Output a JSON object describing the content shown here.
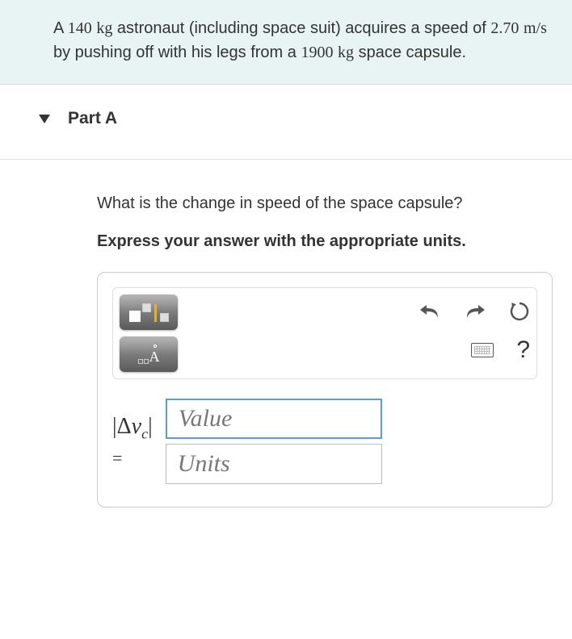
{
  "problem": {
    "mass_astronaut": "140",
    "unit_kg": "kg",
    "text1": "A ",
    "text2": " astronaut (including space suit) acquires a speed of ",
    "speed": "2.70",
    "unit_ms": "m/s",
    "text3": " by pushing off with his legs from a ",
    "mass_capsule": "1900",
    "text4": " space capsule."
  },
  "part": {
    "label": "Part A",
    "question": "What is the change in speed of the space capsule?",
    "instruction": "Express your answer with the appropriate units."
  },
  "answer": {
    "var_abs_open": "|",
    "var_delta": "Δ",
    "var_v": "v",
    "var_sub": "c",
    "var_abs_close": "|",
    "var_eq": "=",
    "value_placeholder": "Value",
    "units_placeholder": "Units"
  },
  "icons": {
    "template": "template-icon",
    "degree": "degree-icon",
    "undo": "undo-icon",
    "redo": "redo-icon",
    "reset": "reset-icon",
    "keyboard": "keyboard-icon",
    "help": "help-icon"
  }
}
